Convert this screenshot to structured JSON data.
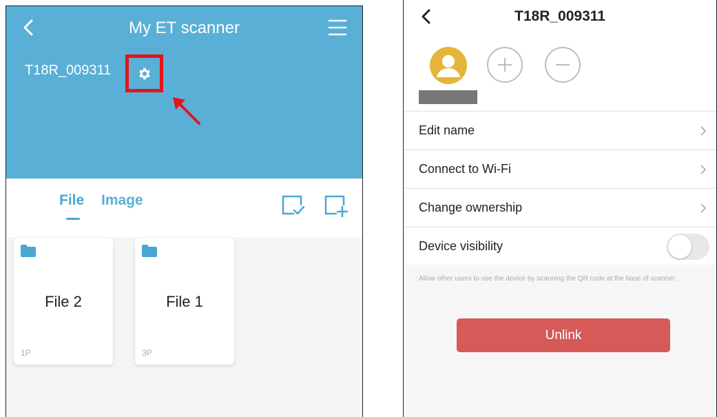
{
  "left_screen": {
    "header": {
      "title": "My ET scanner",
      "back_icon": "chevron-left-icon",
      "menu_icon": "hamburger-menu-icon",
      "device_name": "T18R_009311",
      "settings_icon": "gear-icon",
      "highlight_color": "#e4141b",
      "background_color": "#5aafd6"
    },
    "tabs": [
      {
        "label": "File",
        "active": true
      },
      {
        "label": "Image",
        "active": false
      }
    ],
    "toolbar": {
      "select_icon": "select-check-icon",
      "new_folder_icon": "add-folder-icon"
    },
    "files": [
      {
        "name": "File 2",
        "pages": "1P"
      },
      {
        "name": "File 1",
        "pages": "3P"
      }
    ]
  },
  "right_screen": {
    "header": {
      "title": "T18R_009311",
      "back_icon": "chevron-left-icon"
    },
    "members": {
      "avatar_icon": "user-avatar-icon",
      "add_icon": "plus-icon",
      "remove_icon": "minus-icon"
    },
    "settings": [
      {
        "label": "Edit name"
      },
      {
        "label": "Connect to Wi-Fi"
      },
      {
        "label": "Change ownership"
      },
      {
        "label": "Device visibility",
        "toggle": false
      }
    ],
    "visibility_note": "Allow other users to use the device by scanning the QR code at the base of scanner.",
    "unlink_label": "Unlink",
    "unlink_color": "#d65a58"
  }
}
